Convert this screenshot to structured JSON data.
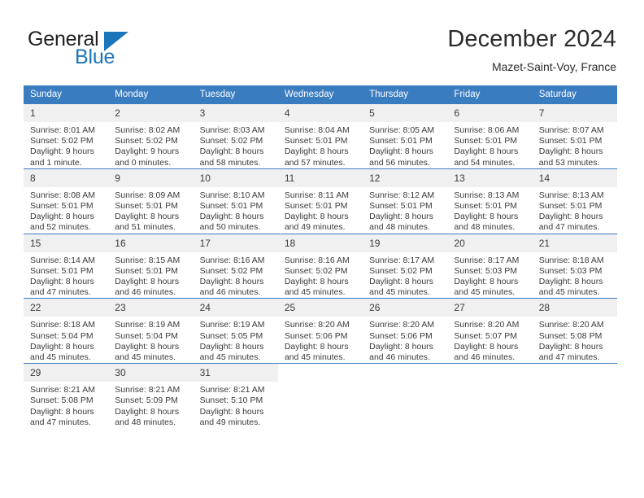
{
  "brand": {
    "name_part1": "General",
    "name_part2": "Blue",
    "accent_color": "#1b75bb"
  },
  "header": {
    "title": "December 2024",
    "subtitle": "Mazet-Saint-Voy, France"
  },
  "table": {
    "header_bg": "#3a7cc0",
    "daynum_bg": "#f0f0f0",
    "weekdays": [
      "Sunday",
      "Monday",
      "Tuesday",
      "Wednesday",
      "Thursday",
      "Friday",
      "Saturday"
    ]
  },
  "weeks": [
    [
      {
        "day": "1",
        "sunrise": "Sunrise: 8:01 AM",
        "sunset": "Sunset: 5:02 PM",
        "daylight_line1": "Daylight: 9 hours",
        "daylight_line2": "and 1 minute."
      },
      {
        "day": "2",
        "sunrise": "Sunrise: 8:02 AM",
        "sunset": "Sunset: 5:02 PM",
        "daylight_line1": "Daylight: 9 hours",
        "daylight_line2": "and 0 minutes."
      },
      {
        "day": "3",
        "sunrise": "Sunrise: 8:03 AM",
        "sunset": "Sunset: 5:02 PM",
        "daylight_line1": "Daylight: 8 hours",
        "daylight_line2": "and 58 minutes."
      },
      {
        "day": "4",
        "sunrise": "Sunrise: 8:04 AM",
        "sunset": "Sunset: 5:01 PM",
        "daylight_line1": "Daylight: 8 hours",
        "daylight_line2": "and 57 minutes."
      },
      {
        "day": "5",
        "sunrise": "Sunrise: 8:05 AM",
        "sunset": "Sunset: 5:01 PM",
        "daylight_line1": "Daylight: 8 hours",
        "daylight_line2": "and 56 minutes."
      },
      {
        "day": "6",
        "sunrise": "Sunrise: 8:06 AM",
        "sunset": "Sunset: 5:01 PM",
        "daylight_line1": "Daylight: 8 hours",
        "daylight_line2": "and 54 minutes."
      },
      {
        "day": "7",
        "sunrise": "Sunrise: 8:07 AM",
        "sunset": "Sunset: 5:01 PM",
        "daylight_line1": "Daylight: 8 hours",
        "daylight_line2": "and 53 minutes."
      }
    ],
    [
      {
        "day": "8",
        "sunrise": "Sunrise: 8:08 AM",
        "sunset": "Sunset: 5:01 PM",
        "daylight_line1": "Daylight: 8 hours",
        "daylight_line2": "and 52 minutes."
      },
      {
        "day": "9",
        "sunrise": "Sunrise: 8:09 AM",
        "sunset": "Sunset: 5:01 PM",
        "daylight_line1": "Daylight: 8 hours",
        "daylight_line2": "and 51 minutes."
      },
      {
        "day": "10",
        "sunrise": "Sunrise: 8:10 AM",
        "sunset": "Sunset: 5:01 PM",
        "daylight_line1": "Daylight: 8 hours",
        "daylight_line2": "and 50 minutes."
      },
      {
        "day": "11",
        "sunrise": "Sunrise: 8:11 AM",
        "sunset": "Sunset: 5:01 PM",
        "daylight_line1": "Daylight: 8 hours",
        "daylight_line2": "and 49 minutes."
      },
      {
        "day": "12",
        "sunrise": "Sunrise: 8:12 AM",
        "sunset": "Sunset: 5:01 PM",
        "daylight_line1": "Daylight: 8 hours",
        "daylight_line2": "and 48 minutes."
      },
      {
        "day": "13",
        "sunrise": "Sunrise: 8:13 AM",
        "sunset": "Sunset: 5:01 PM",
        "daylight_line1": "Daylight: 8 hours",
        "daylight_line2": "and 48 minutes."
      },
      {
        "day": "14",
        "sunrise": "Sunrise: 8:13 AM",
        "sunset": "Sunset: 5:01 PM",
        "daylight_line1": "Daylight: 8 hours",
        "daylight_line2": "and 47 minutes."
      }
    ],
    [
      {
        "day": "15",
        "sunrise": "Sunrise: 8:14 AM",
        "sunset": "Sunset: 5:01 PM",
        "daylight_line1": "Daylight: 8 hours",
        "daylight_line2": "and 47 minutes."
      },
      {
        "day": "16",
        "sunrise": "Sunrise: 8:15 AM",
        "sunset": "Sunset: 5:01 PM",
        "daylight_line1": "Daylight: 8 hours",
        "daylight_line2": "and 46 minutes."
      },
      {
        "day": "17",
        "sunrise": "Sunrise: 8:16 AM",
        "sunset": "Sunset: 5:02 PM",
        "daylight_line1": "Daylight: 8 hours",
        "daylight_line2": "and 46 minutes."
      },
      {
        "day": "18",
        "sunrise": "Sunrise: 8:16 AM",
        "sunset": "Sunset: 5:02 PM",
        "daylight_line1": "Daylight: 8 hours",
        "daylight_line2": "and 45 minutes."
      },
      {
        "day": "19",
        "sunrise": "Sunrise: 8:17 AM",
        "sunset": "Sunset: 5:02 PM",
        "daylight_line1": "Daylight: 8 hours",
        "daylight_line2": "and 45 minutes."
      },
      {
        "day": "20",
        "sunrise": "Sunrise: 8:17 AM",
        "sunset": "Sunset: 5:03 PM",
        "daylight_line1": "Daylight: 8 hours",
        "daylight_line2": "and 45 minutes."
      },
      {
        "day": "21",
        "sunrise": "Sunrise: 8:18 AM",
        "sunset": "Sunset: 5:03 PM",
        "daylight_line1": "Daylight: 8 hours",
        "daylight_line2": "and 45 minutes."
      }
    ],
    [
      {
        "day": "22",
        "sunrise": "Sunrise: 8:18 AM",
        "sunset": "Sunset: 5:04 PM",
        "daylight_line1": "Daylight: 8 hours",
        "daylight_line2": "and 45 minutes."
      },
      {
        "day": "23",
        "sunrise": "Sunrise: 8:19 AM",
        "sunset": "Sunset: 5:04 PM",
        "daylight_line1": "Daylight: 8 hours",
        "daylight_line2": "and 45 minutes."
      },
      {
        "day": "24",
        "sunrise": "Sunrise: 8:19 AM",
        "sunset": "Sunset: 5:05 PM",
        "daylight_line1": "Daylight: 8 hours",
        "daylight_line2": "and 45 minutes."
      },
      {
        "day": "25",
        "sunrise": "Sunrise: 8:20 AM",
        "sunset": "Sunset: 5:06 PM",
        "daylight_line1": "Daylight: 8 hours",
        "daylight_line2": "and 45 minutes."
      },
      {
        "day": "26",
        "sunrise": "Sunrise: 8:20 AM",
        "sunset": "Sunset: 5:06 PM",
        "daylight_line1": "Daylight: 8 hours",
        "daylight_line2": "and 46 minutes."
      },
      {
        "day": "27",
        "sunrise": "Sunrise: 8:20 AM",
        "sunset": "Sunset: 5:07 PM",
        "daylight_line1": "Daylight: 8 hours",
        "daylight_line2": "and 46 minutes."
      },
      {
        "day": "28",
        "sunrise": "Sunrise: 8:20 AM",
        "sunset": "Sunset: 5:08 PM",
        "daylight_line1": "Daylight: 8 hours",
        "daylight_line2": "and 47 minutes."
      }
    ],
    [
      {
        "day": "29",
        "sunrise": "Sunrise: 8:21 AM",
        "sunset": "Sunset: 5:08 PM",
        "daylight_line1": "Daylight: 8 hours",
        "daylight_line2": "and 47 minutes."
      },
      {
        "day": "30",
        "sunrise": "Sunrise: 8:21 AM",
        "sunset": "Sunset: 5:09 PM",
        "daylight_line1": "Daylight: 8 hours",
        "daylight_line2": "and 48 minutes."
      },
      {
        "day": "31",
        "sunrise": "Sunrise: 8:21 AM",
        "sunset": "Sunset: 5:10 PM",
        "daylight_line1": "Daylight: 8 hours",
        "daylight_line2": "and 49 minutes."
      },
      null,
      null,
      null,
      null
    ]
  ]
}
